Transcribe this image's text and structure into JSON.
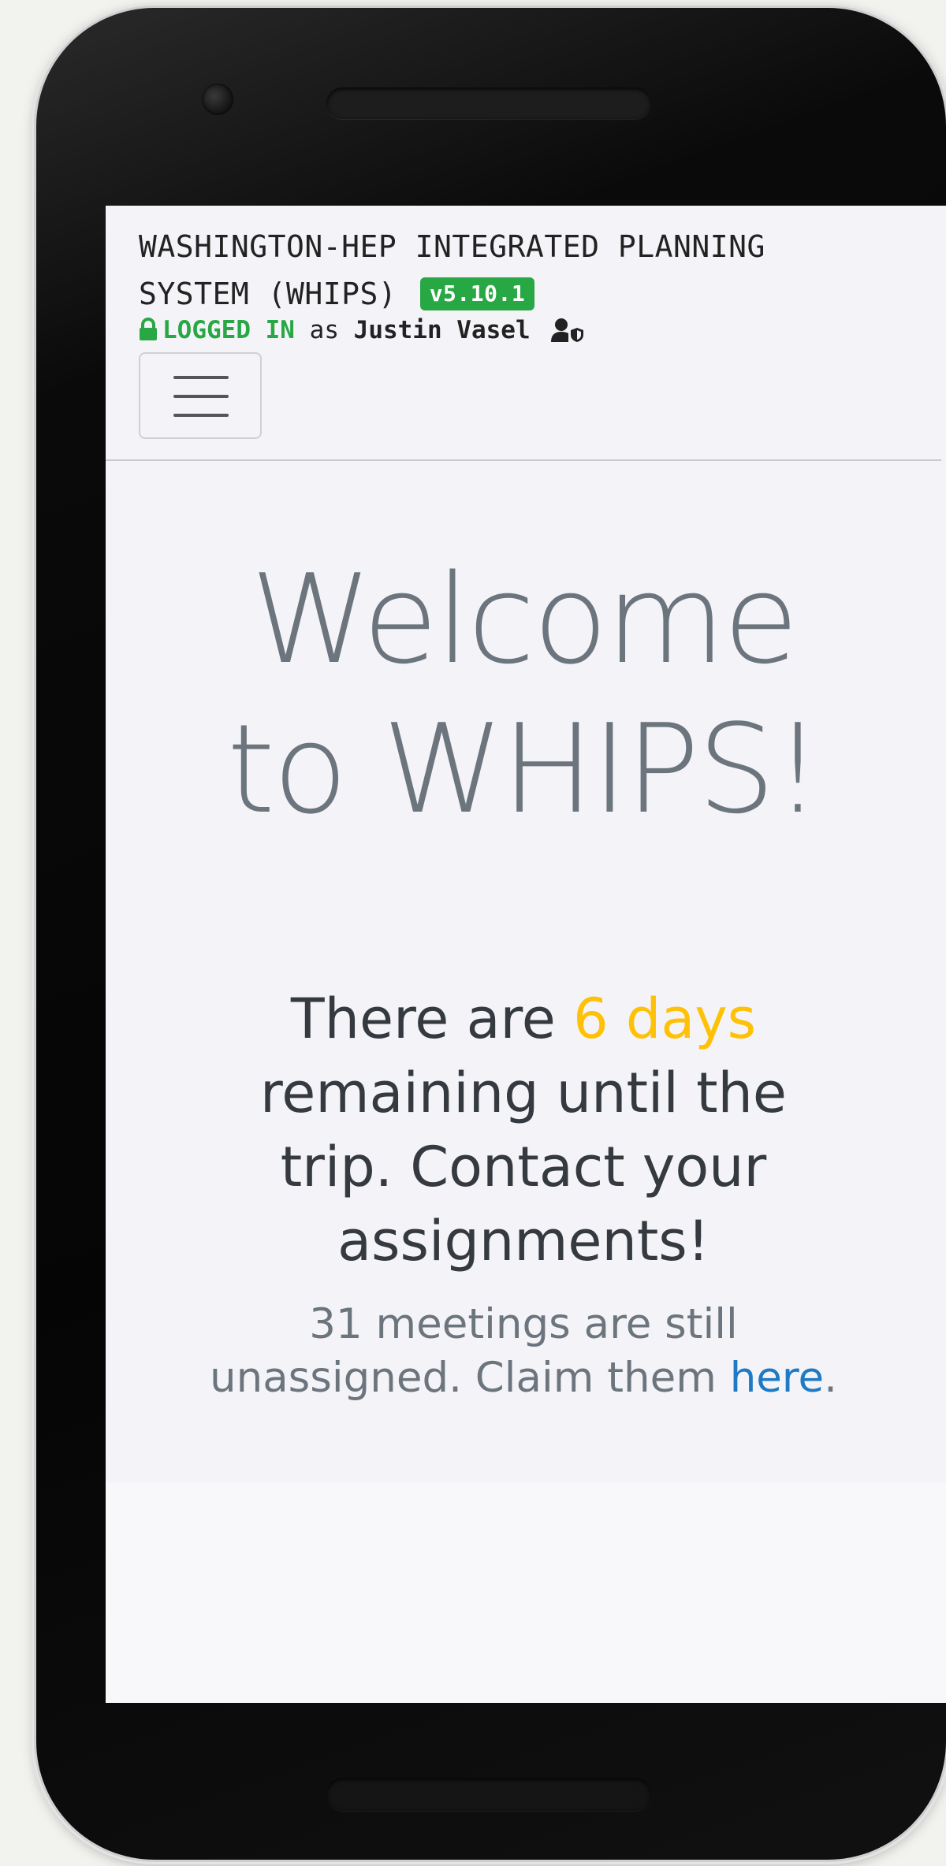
{
  "header": {
    "brand_title": "WASHINGTON-HEP INTEGRATED PLANNING SYSTEM (WHIPS)",
    "version": "v5.10.1",
    "login_status": "LOGGED IN",
    "login_as": "as",
    "user_name": "Justin Vasel"
  },
  "main": {
    "welcome_line1": "Welcome",
    "welcome_line2": "to WHIPS!",
    "countdown_prefix": "There are",
    "countdown_days": "6 days",
    "countdown_suffix": "remaining until the trip. Contact your assignments!",
    "meetings_text": "31 meetings are still unassigned. Claim them",
    "meetings_link": "here",
    "meetings_end": "."
  },
  "colors": {
    "badge_green": "#28a745",
    "days_highlight": "#ffc107",
    "link_blue": "#1e7ac4",
    "muted_gray": "#6c757d"
  },
  "icons": [
    "lock-icon",
    "user-shield-icon",
    "hamburger-menu-icon"
  ]
}
